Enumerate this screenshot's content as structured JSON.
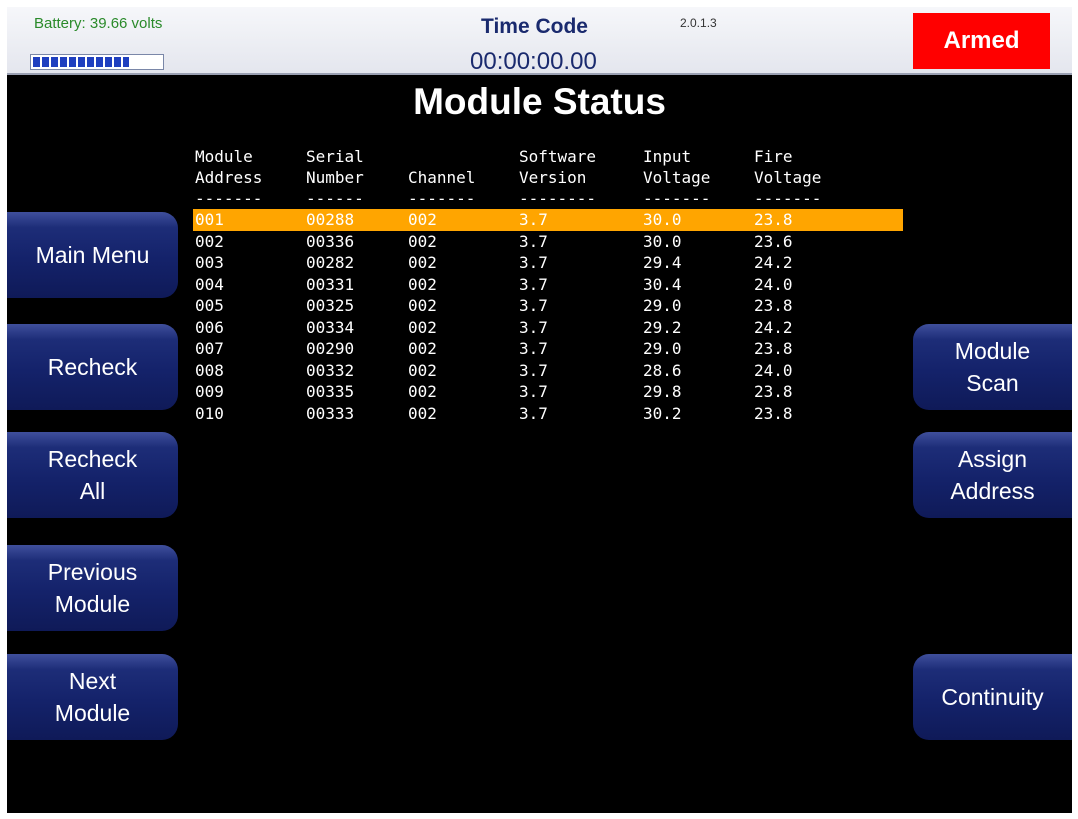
{
  "header": {
    "battery_label": "Battery: 39.66 volts",
    "battery_level_percent": 75,
    "timecode_title": "Time Code",
    "version": "2.0.1.3",
    "timecode_value": "00:00:00.00",
    "armed_label": "Armed"
  },
  "page_title": "Module Status",
  "table": {
    "columns": [
      "Module\nAddress\n-------",
      "Serial\nNumber\n------",
      "\nChannel\n-------",
      "Software\nVersion\n--------",
      "Input\nVoltage\n-------",
      "Fire\nVoltage\n-------"
    ],
    "selected_row": 0,
    "rows": [
      [
        "001",
        "00288",
        "002",
        "3.7",
        "30.0",
        "23.8"
      ],
      [
        "002",
        "00336",
        "002",
        "3.7",
        "30.0",
        "23.6"
      ],
      [
        "003",
        "00282",
        "002",
        "3.7",
        "29.4",
        "24.2"
      ],
      [
        "004",
        "00331",
        "002",
        "3.7",
        "30.4",
        "24.0"
      ],
      [
        "005",
        "00325",
        "002",
        "3.7",
        "29.0",
        "23.8"
      ],
      [
        "006",
        "00334",
        "002",
        "3.7",
        "29.2",
        "24.2"
      ],
      [
        "007",
        "00290",
        "002",
        "3.7",
        "29.0",
        "23.8"
      ],
      [
        "008",
        "00332",
        "002",
        "3.7",
        "28.6",
        "24.0"
      ],
      [
        "009",
        "00335",
        "002",
        "3.7",
        "29.8",
        "23.8"
      ],
      [
        "010",
        "00333",
        "002",
        "3.7",
        "30.2",
        "23.8"
      ]
    ]
  },
  "left_buttons": {
    "main_menu": "Main Menu",
    "recheck": "Recheck",
    "recheck_all": "Recheck\nAll",
    "previous_module": "Previous\nModule",
    "next_module": "Next\nModule"
  },
  "right_buttons": {
    "module_scan": "Module\nScan",
    "assign_address": "Assign\nAddress",
    "continuity": "Continuity"
  },
  "colors": {
    "background": "#000000",
    "selected_row": "#ffa500",
    "armed": "#ff0000",
    "button": "#14226a",
    "title_text": "#1a2a6e",
    "battery_text": "#2a8a2a"
  }
}
